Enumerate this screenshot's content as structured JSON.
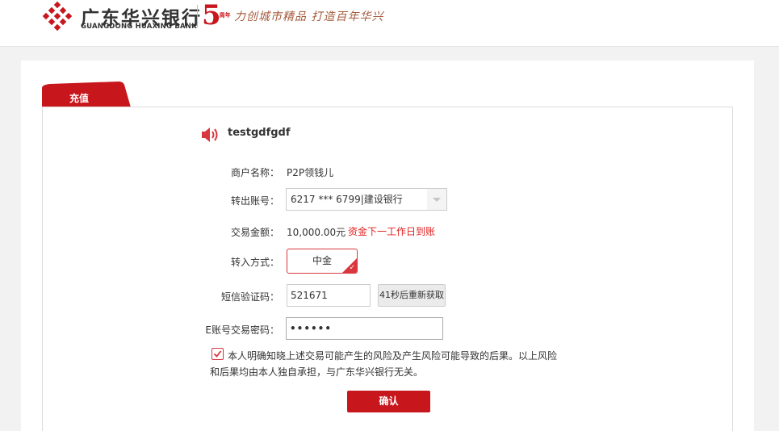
{
  "header": {
    "bank_name_cn": "广东华兴银行",
    "bank_name_en": "GUANGDONG HUAXING BANK",
    "anniversary_number": "5",
    "anniversary_suffix": "周年",
    "slogan": "力创城市精品  打造百年华兴",
    "brand_color": "#c8161d"
  },
  "tab": {
    "label": "充值"
  },
  "account": {
    "icon": "speaker-icon",
    "name": "testgdfgdf"
  },
  "form": {
    "merchant": {
      "label": "商户名称：",
      "value": "P2P领钱儿"
    },
    "out_account": {
      "label": "转出账号：",
      "value": "6217 *** 6799|建设银行"
    },
    "amount": {
      "label": "交易金额：",
      "value": "10,000.00元",
      "note": "资金下一工作日到账"
    },
    "method": {
      "label": "转入方式：",
      "value": "中金"
    },
    "sms": {
      "label": "短信验证码：",
      "value": "521671",
      "resend_label": "41秒后重新获取"
    },
    "password": {
      "label": "E账号交易密码：",
      "value": "••••••"
    }
  },
  "agreement": {
    "checked": true,
    "text": "本人明确知晓上述交易可能产生的风险及产生风险可能导致的后果。以上风险和后果均由本人独自承担，与广东华兴银行无关。"
  },
  "actions": {
    "confirm_label": "确认"
  },
  "colors": {
    "accent": "#c8161d",
    "warning_text": "#e02020"
  }
}
